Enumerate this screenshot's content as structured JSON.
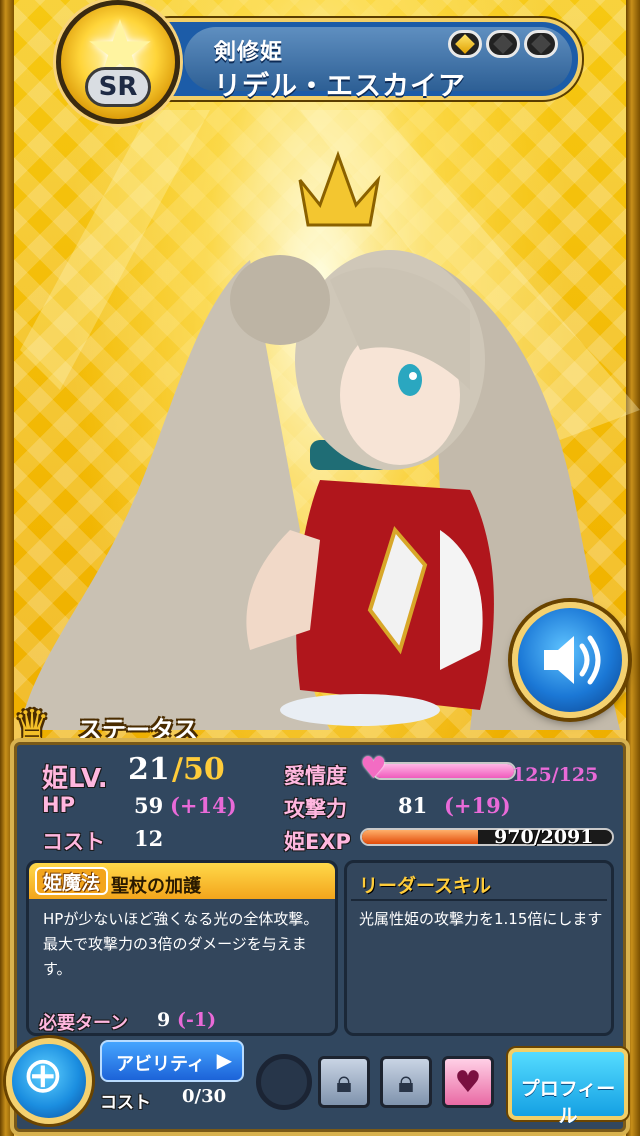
{
  "header": {
    "rarity": "SR",
    "subtitle": "剣修姫",
    "name": "リデル・エスカイア",
    "evolution_gems_filled": 1,
    "evolution_gems_total": 3
  },
  "status": {
    "title": "ステータス",
    "hime_lv_label": "姫LV.",
    "level": "21",
    "level_max": "/50",
    "affection_label": "愛情度",
    "affection_text": "125/125",
    "affection_fraction": 1.0,
    "hp_label": "HP",
    "hp_value": "59",
    "hp_bonus": "(+14)",
    "attack_label": "攻撃力",
    "attack_value": "81",
    "attack_bonus": "(+19)",
    "cost_label": "コスト",
    "cost_value": "12",
    "exp_label": "姫EXP",
    "exp_text": "970/2091",
    "exp_fraction": 0.464
  },
  "magic": {
    "tag": "姫魔法",
    "name": "聖杖の加護",
    "description": "HPが少ないほど強くなる光の全体攻撃。最大で攻撃力の3倍のダメージを与えます。",
    "turn_label": "必要ターン",
    "turn_value": "9",
    "turn_bonus": "(-1)"
  },
  "leader": {
    "title": "リーダースキル",
    "description": "光属性姫の攻撃力を1.15倍にします"
  },
  "footer": {
    "ability_label": "アビリティ",
    "cost_label": "コスト",
    "cost_value": "0/30",
    "profile_label": "プロフィール"
  },
  "colors": {
    "accent_gold": "#f2cf67",
    "panel_bg": "#31475f",
    "bonus_pink": "#e96ad8",
    "button_blue": "#1c63d8"
  }
}
